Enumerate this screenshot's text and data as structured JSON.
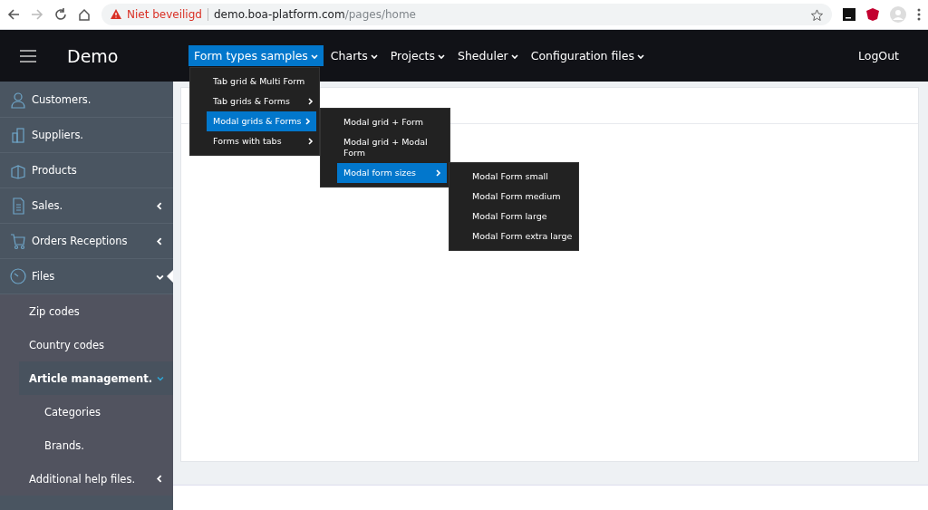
{
  "browser": {
    "security_warning": "Niet beveiligd",
    "url_host": "demo.boa-platform.com",
    "url_path": "/pages/home"
  },
  "navbar": {
    "brand": "Demo",
    "menus": [
      {
        "label": "Form types samples",
        "selected": true,
        "items": [
          {
            "label": "Tab grid & Multi Form",
            "has_submenu": false,
            "selected": false
          },
          {
            "label": "Tab grids & Forms",
            "has_submenu": true,
            "selected": false
          },
          {
            "label": "Modal grids & Forms",
            "has_submenu": true,
            "selected": true,
            "children": [
              {
                "label": "Modal grid + Form",
                "has_submenu": false,
                "selected": false
              },
              {
                "label": "Modal grid + Modal Form",
                "has_submenu": false,
                "selected": false
              },
              {
                "label": "Modal form sizes",
                "has_submenu": true,
                "selected": true,
                "children": [
                  {
                    "label": "Modal Form small",
                    "has_submenu": false,
                    "selected": false
                  },
                  {
                    "label": "Modal Form medium",
                    "has_submenu": false,
                    "selected": false
                  },
                  {
                    "label": "Modal Form large",
                    "has_submenu": false,
                    "selected": false
                  },
                  {
                    "label": "Modal Form extra large",
                    "has_submenu": false,
                    "selected": false
                  }
                ]
              }
            ]
          },
          {
            "label": "Forms with tabs",
            "has_submenu": true,
            "selected": false
          }
        ]
      },
      {
        "label": "Charts",
        "selected": false
      },
      {
        "label": "Projects",
        "selected": false
      },
      {
        "label": "Sheduler",
        "selected": false
      },
      {
        "label": "Configuration files",
        "selected": false
      }
    ],
    "logout": "LogOut"
  },
  "sidebar": {
    "items": [
      {
        "label": "Customers.",
        "expandable": false,
        "expanded": false,
        "selected": false
      },
      {
        "label": "Suppliers.",
        "expandable": false,
        "expanded": false,
        "selected": false
      },
      {
        "label": "Products",
        "expandable": false,
        "expanded": false,
        "selected": false
      },
      {
        "label": "Sales.",
        "expandable": true,
        "expanded": false,
        "selected": false
      },
      {
        "label": "Orders Receptions",
        "expandable": true,
        "expanded": false,
        "selected": false
      },
      {
        "label": "Files",
        "expandable": true,
        "expanded": true,
        "selected": false,
        "children": [
          {
            "label": "Zip codes",
            "expandable": false,
            "expanded": false,
            "selected": false
          },
          {
            "label": "Country codes",
            "expandable": false,
            "expanded": false,
            "selected": false
          },
          {
            "label": "Article management.",
            "expandable": true,
            "expanded": true,
            "selected": true,
            "children": [
              {
                "label": "Categories",
                "expandable": false,
                "expanded": false,
                "selected": false
              },
              {
                "label": "Brands.",
                "expandable": false,
                "expanded": false,
                "selected": false
              }
            ]
          },
          {
            "label": "Additional help files.",
            "expandable": true,
            "expanded": false,
            "selected": false
          }
        ]
      }
    ]
  }
}
